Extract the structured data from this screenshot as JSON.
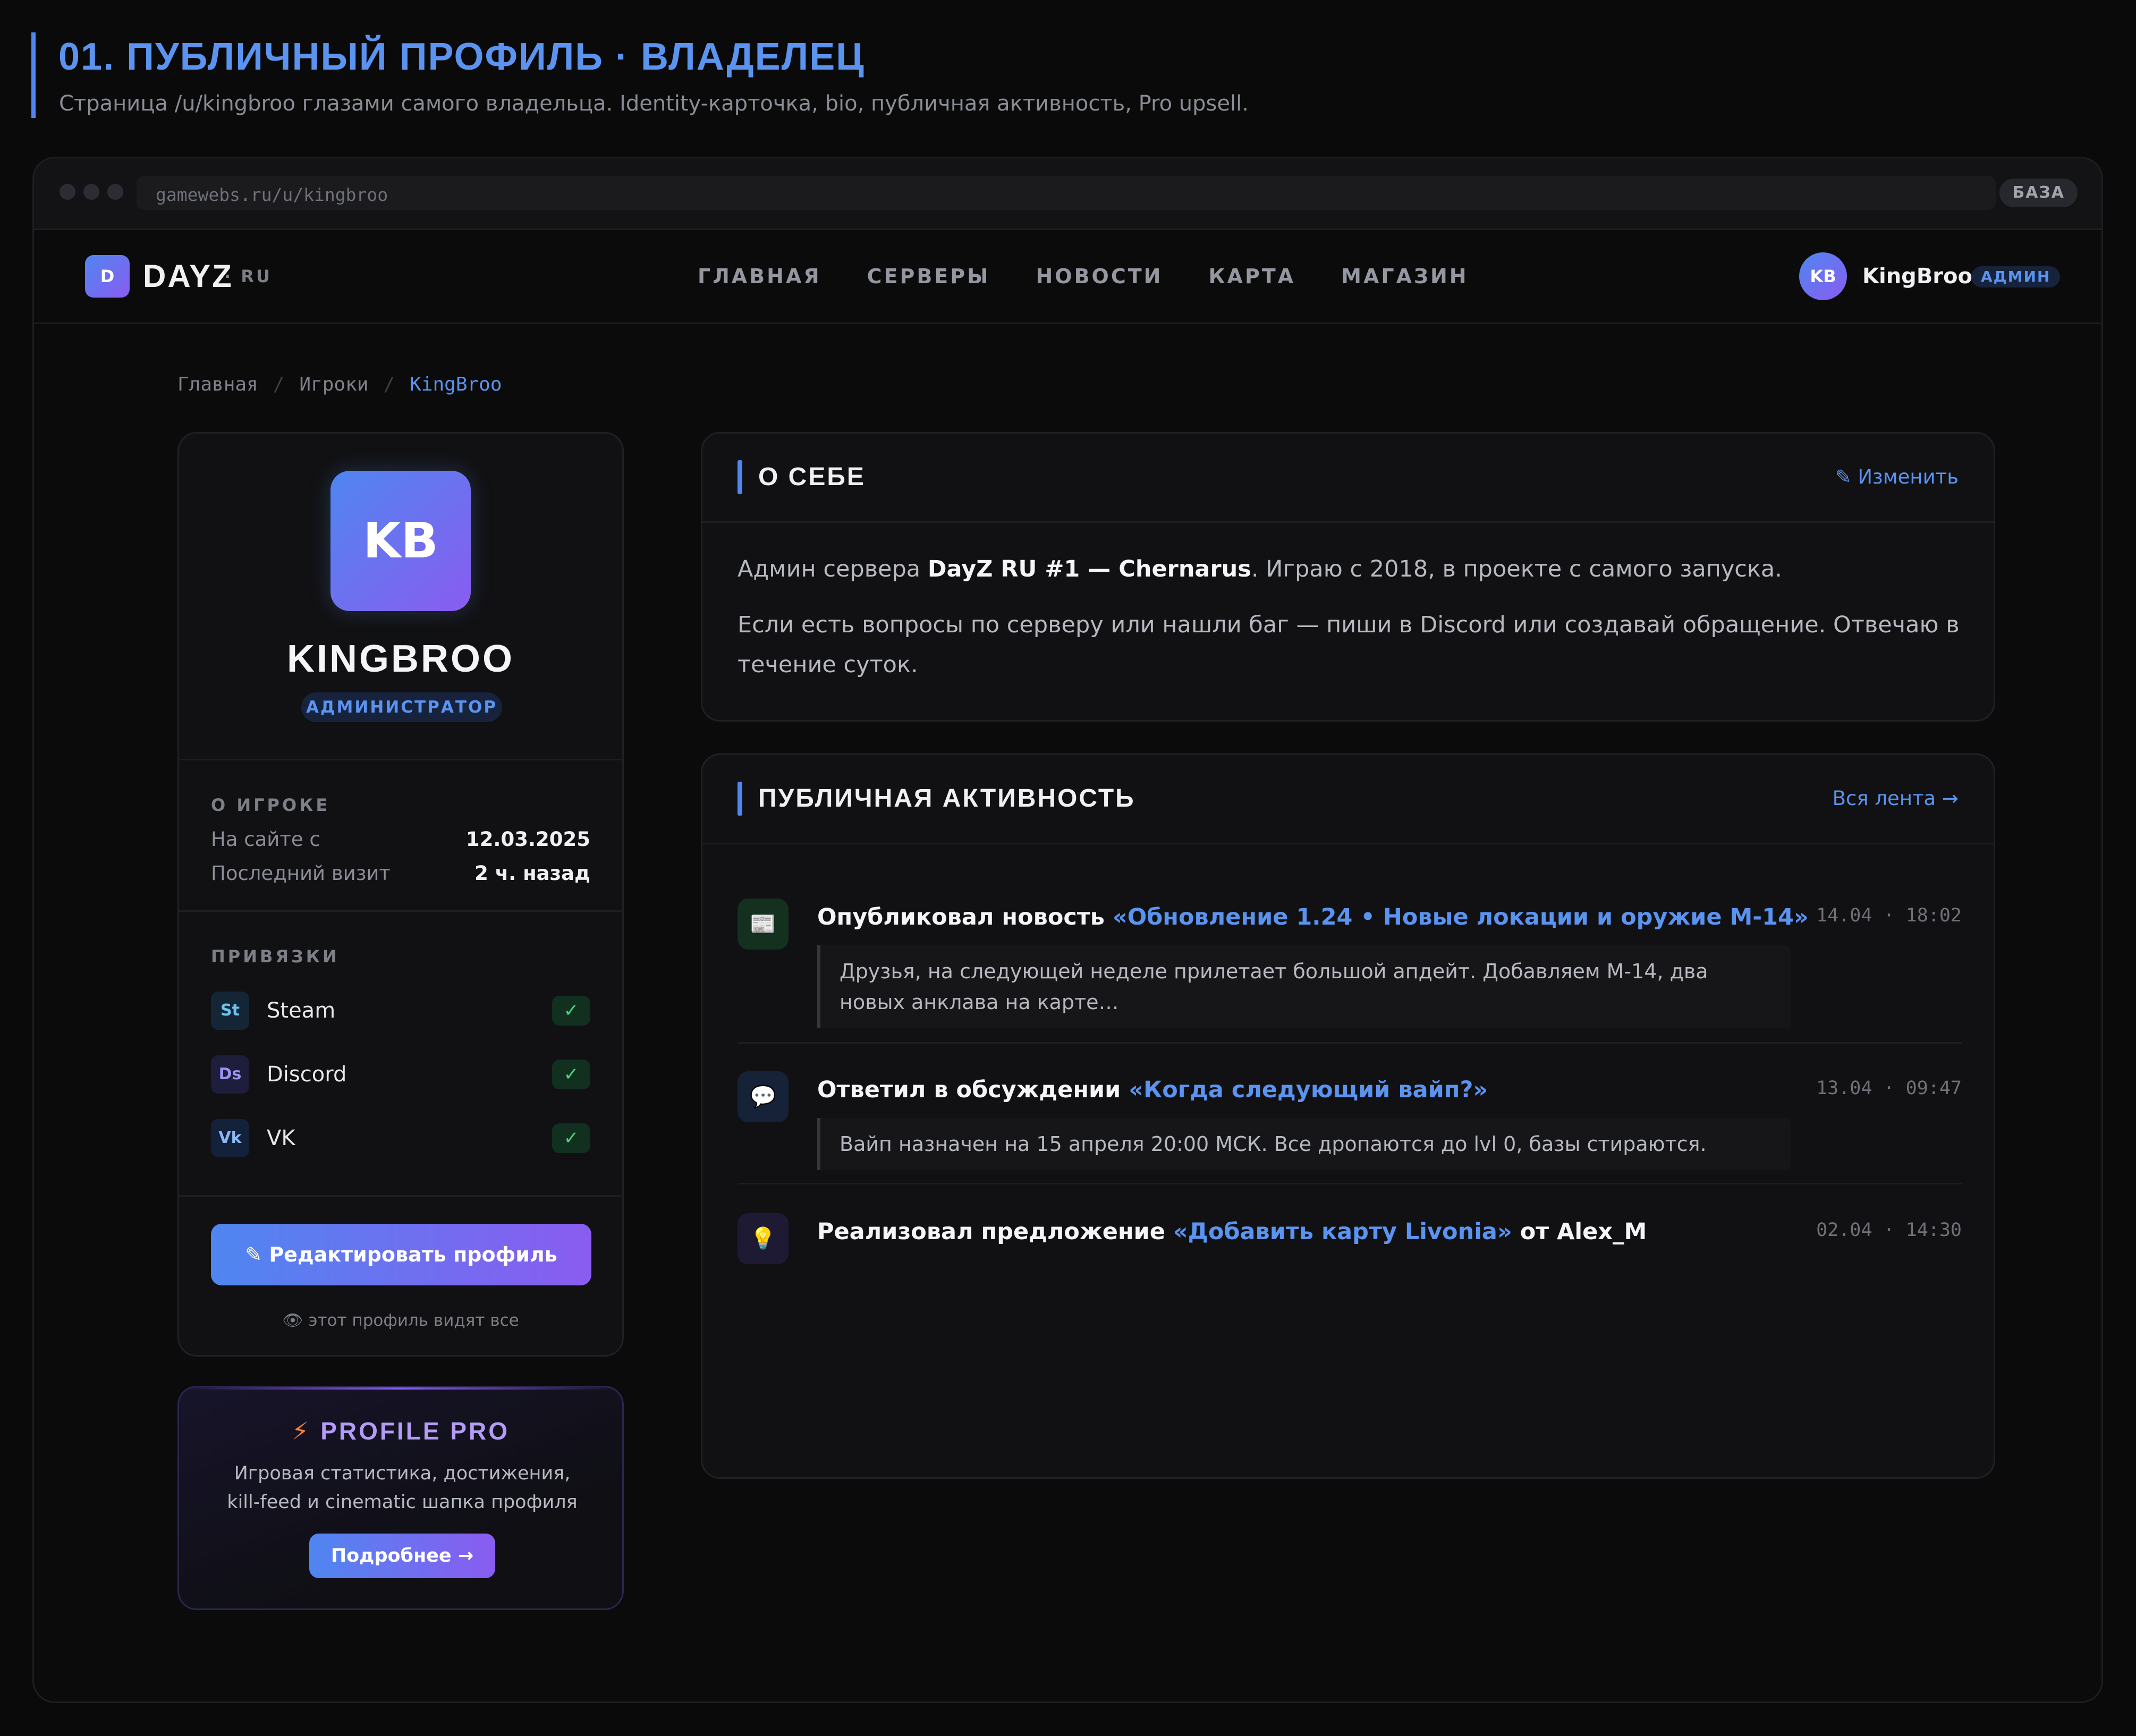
{
  "header": {
    "title": "01. ПУБЛИЧНЫЙ ПРОФИЛЬ · ВЛАДЕЛЕЦ",
    "subtitle": "Страница /u/kingbroo глазами самого владельца. Identity-карточка, bio, публичная активность, Pro upsell."
  },
  "browser": {
    "url": "gamewebs.ru/u/kingbroo",
    "env_badge": "БАЗА"
  },
  "site_nav": {
    "logo_letter": "D",
    "logo_word": "DAYZ",
    "logo_suffix": "· RU",
    "links": [
      "ГЛАВНАЯ",
      "СЕРВЕРЫ",
      "НОВОСТИ",
      "КАРТА",
      "МАГАЗИН"
    ],
    "user": {
      "initials": "KB",
      "name": "KingBroo",
      "badge": "АДМИН"
    }
  },
  "breadcrumb": [
    "Главная",
    "/",
    "Игроки",
    "/",
    "KingBroo"
  ],
  "profile": {
    "initials": "KB",
    "name": "KINGBROO",
    "role": "АДМИНИСТРАТОР",
    "about_label": "О ИГРОКЕ",
    "joined_label": "На сайте с",
    "joined_value": "12.03.2025",
    "last_visit_label": "Последний визит",
    "last_visit_value": "2 ч. назад",
    "links_label": "ПРИВЯЗКИ",
    "links": [
      {
        "abbr": "St",
        "name": "Steam",
        "check": "✓"
      },
      {
        "abbr": "Ds",
        "name": "Discord",
        "check": "✓"
      },
      {
        "abbr": "Vk",
        "name": "VK",
        "check": "✓"
      }
    ],
    "edit_button": "✎ Редактировать профиль",
    "visibility_note": "👁 этот профиль видят все"
  },
  "pro": {
    "icon": "⚡",
    "title": "PROFILE PRO",
    "description": "Игровая статистика, достижения, kill-feed и cinematic шапка профиля",
    "button": "Подробнее →"
  },
  "about": {
    "title": "О СЕБЕ",
    "edit_link": "✎ Изменить",
    "p1_a": "Админ сервера ",
    "p1_b": "DayZ RU #1 — Chernarus",
    "p1_c": ". Играю с 2018, в проекте с самого запуска.",
    "p2": "Если есть вопросы по серверу или нашли баг — пиши в Discord или создавай обращение. Отвечаю в течение суток."
  },
  "activity": {
    "title": "ПУБЛИЧНАЯ АКТИВНОСТЬ",
    "all_link": "Вся лента →",
    "items": [
      {
        "icon": "📰",
        "prefix": "Опубликовал новость ",
        "highlight": "«Обновление 1.24 • Новые локации и оружие M-14»",
        "suffix": "",
        "time": "14.04 · 18:02",
        "quote": "Друзья, на следующей неделе прилетает большой апдейт. Добавляем M-14, два новых анклава на карте…"
      },
      {
        "icon": "💬",
        "prefix": "Ответил в обсуждении ",
        "highlight": "«Когда следующий вайп?»",
        "suffix": "",
        "time": "13.04 · 09:47",
        "quote": "Вайп назначен на 15 апреля 20:00 МСК. Все дропаются до lvl 0, базы стираются."
      },
      {
        "icon": "💡",
        "prefix": "Реализовал предложение ",
        "highlight": "«Добавить карту Livonia»",
        "suffix": " от Alex_M",
        "time": "02.04 · 14:30",
        "quote": ""
      }
    ]
  },
  "colors": {
    "accent": "#5b93f0",
    "accent_gradient_end": "#8a5cf0",
    "background": "#0a0a0b",
    "card": "#111113",
    "success": "#4cd37a"
  }
}
